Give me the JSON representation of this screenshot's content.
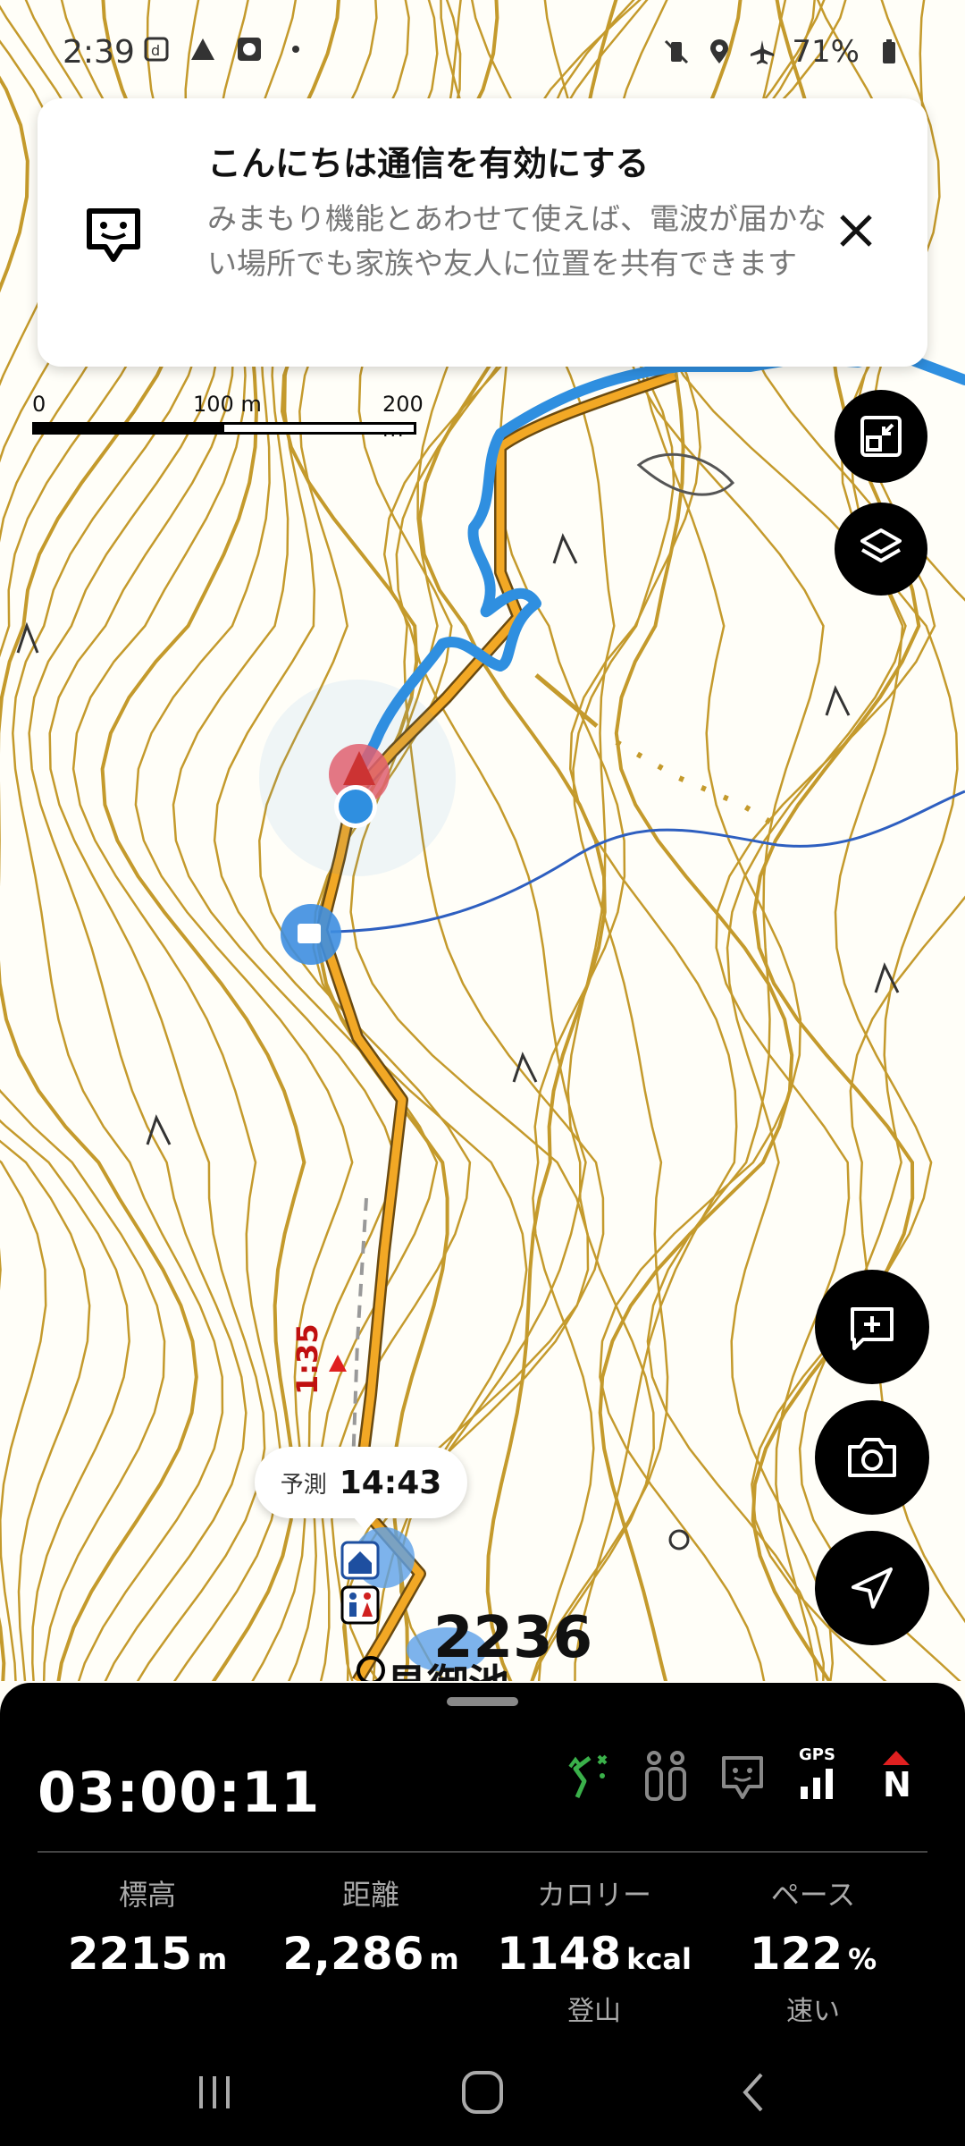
{
  "status_bar": {
    "time": "2:39",
    "battery": "71%",
    "left_icons": [
      "d-icon",
      "signal-triangle-icon",
      "app-notification-icon",
      "dot-icon"
    ],
    "right_icons": [
      "vibrate-mute-icon",
      "location-icon",
      "airplane-icon",
      "battery-icon"
    ]
  },
  "banner": {
    "title": "こんにちは通信を有効にする",
    "body": "みまもり機能とあわせて使えば、電波が届かない場所でも家族や友人に位置を共有できます"
  },
  "scale": {
    "labels": [
      "0",
      "100 m",
      "200 m"
    ]
  },
  "map": {
    "forecast_label": "予測",
    "forecast_time": "14:43",
    "summit_label": "2236",
    "pond_label": "見御池",
    "course_time": "1:35"
  },
  "fabs": [
    "fit-route-icon",
    "layers-icon",
    "add-memo-icon",
    "camera-icon",
    "navigate-icon"
  ],
  "panel": {
    "elapsed": "03:00:11",
    "status_icons": [
      "route-icon",
      "walkie-icon",
      "mimamori-icon",
      "gps-signal-icon",
      "compass-north-icon"
    ],
    "gps_label": "GPS",
    "north_label": "N",
    "stats": [
      {
        "label": "標高",
        "value": "2215",
        "unit": "m",
        "sub": ""
      },
      {
        "label": "距離",
        "value": "2,286",
        "unit": "m",
        "sub": ""
      },
      {
        "label": "カロリー",
        "value": "1148",
        "unit": "kcal",
        "sub": "登山"
      },
      {
        "label": "ペース",
        "value": "122",
        "unit": "%",
        "sub": "速い"
      }
    ]
  },
  "colors": {
    "contour": "#c49a2c",
    "route": "#f2a825",
    "track": "#2f8fe0",
    "accent": "#e02020"
  }
}
